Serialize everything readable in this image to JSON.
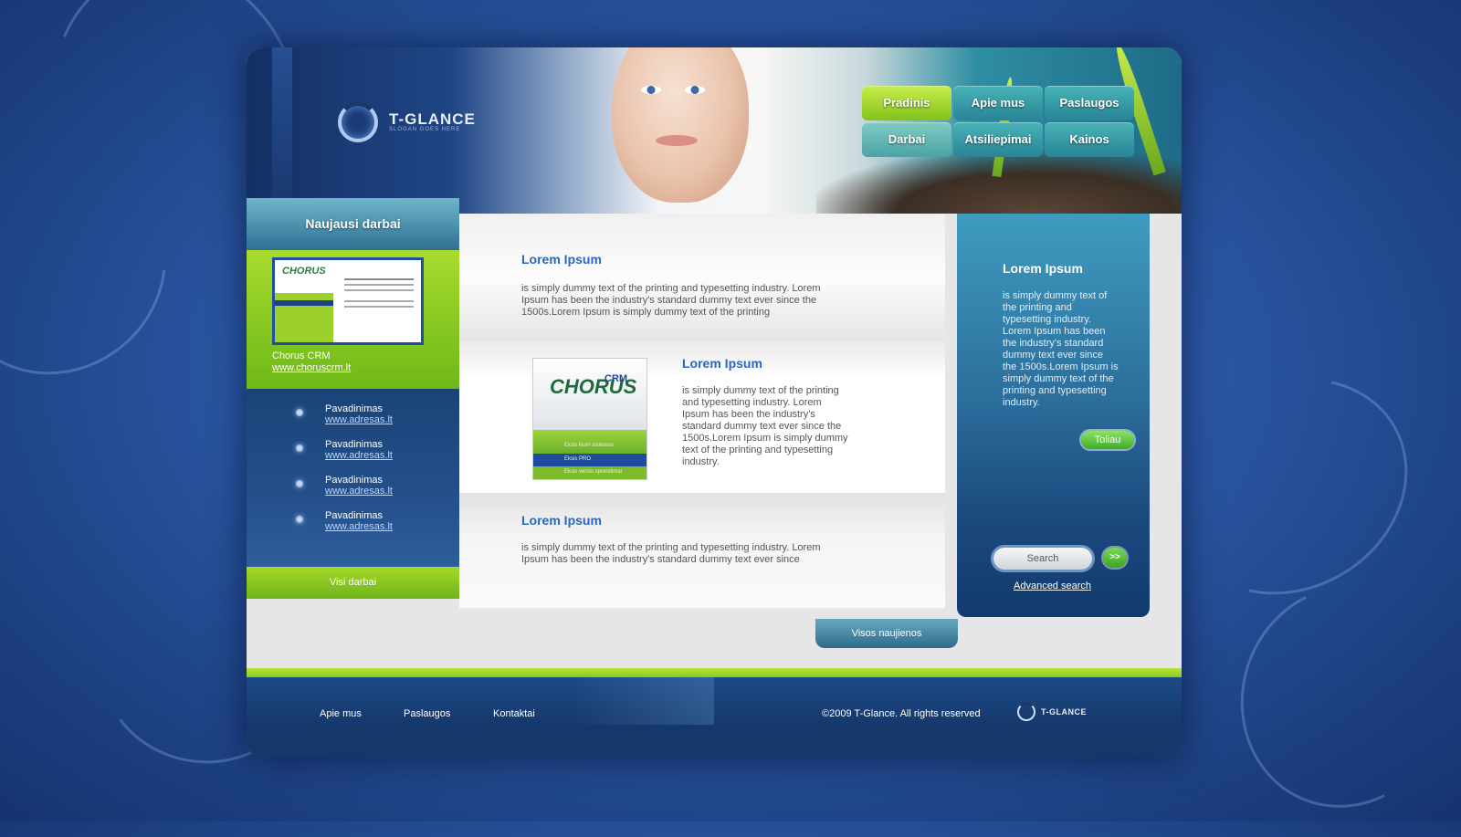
{
  "header": {
    "logo": {
      "name": "T-GLANCE",
      "slogan": "SLOGAN GOES HERE"
    }
  },
  "nav": [
    {
      "label": "Pradinis",
      "active": true
    },
    {
      "label": "Apie mus"
    },
    {
      "label": "Paslaugos"
    },
    {
      "label": "Darbai"
    },
    {
      "label": "Atsiliepimai"
    },
    {
      "label": "Kainos"
    }
  ],
  "left": {
    "title": "Naujausi darbai",
    "feature": {
      "thumb_logo": "CHORUS",
      "name": "Chorus CRM",
      "url": "www.choruscrm.lt"
    },
    "items": [
      {
        "title": "Pavadinimas",
        "url": "www.adresas.lt"
      },
      {
        "title": "Pavadinimas",
        "url": "www.adresas.lt"
      },
      {
        "title": "Pavadinimas",
        "url": "www.adresas.lt"
      },
      {
        "title": "Pavadinimas",
        "url": "www.adresas.lt"
      }
    ],
    "button": "Visi darbai"
  },
  "content": {
    "sections": [
      {
        "title": "Lorem Ipsum",
        "text": " is simply dummy text of the printing and typesetting industry. Lorem Ipsum has been the industry's standard dummy text ever since the 1500s.Lorem Ipsum is simply dummy text of the printing"
      },
      {
        "title": "Lorem Ipsum",
        "text": " is simply dummy text of the printing and typesetting industry. Lorem Ipsum has been the industry's standard dummy text ever since the 1500s.Lorem Ipsum is simply dummy text of the printing and typesetting industry.",
        "image": {
          "logo": "CHORUS",
          "logo_sub": "CRM",
          "lines": [
            "Eksis klum sistemos",
            "Eksis PRO",
            "Eksis versio sprendimai"
          ]
        }
      },
      {
        "title": "Lorem Ipsum",
        "text": " is simply dummy text of the printing and typesetting industry. Lorem Ipsum has been the industry's standard dummy text ever since"
      }
    ],
    "all_news": "Visos naujienos"
  },
  "right": {
    "title": "Lorem Ipsum",
    "text": " is simply dummy text of the printing and typesetting industry. Lorem Ipsum has been the industry's standard dummy text ever since the 1500s.Lorem Ipsum is simply dummy text of the printing and typesetting industry.",
    "more": "Toliau",
    "search": {
      "placeholder": "Search",
      "go": ">>",
      "advanced": "Advanced search"
    }
  },
  "footer": {
    "links": [
      "Apie mus",
      "Paslaugos",
      "Kontaktai"
    ],
    "copyright": "©2009 T-Glance. All rights reserved",
    "logo": "T-GLANCE"
  },
  "colors": {
    "accent_green": "#8bc823",
    "brand_blue": "#1c4b87",
    "title_blue": "#2a67bd"
  }
}
